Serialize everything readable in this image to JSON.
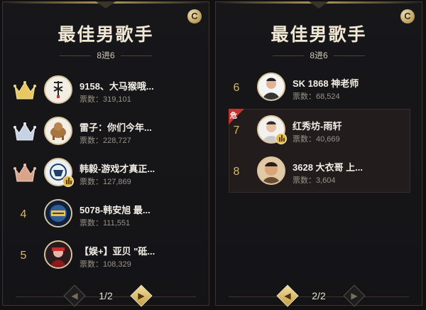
{
  "left": {
    "title": "最佳男歌手",
    "round": "8进6",
    "vote_label": "票数：",
    "items": [
      {
        "rank": "1",
        "crown": "gold",
        "name": "9158、大马猴哦...",
        "votes": "319,101"
      },
      {
        "rank": "2",
        "crown": "silver",
        "name": "雷子：你们今年...",
        "votes": "228,727"
      },
      {
        "rank": "3",
        "crown": "bronze",
        "name": "韩毅-游戏才真正...",
        "votes": "127,869"
      },
      {
        "rank": "4",
        "name": "5078-韩安旭 最...",
        "votes": "111,551"
      },
      {
        "rank": "5",
        "name": "【娱+】亚贝 \"砥...",
        "votes": "108,329"
      }
    ],
    "pagination": {
      "page": "1/2"
    }
  },
  "right": {
    "title": "最佳男歌手",
    "round": "8进6",
    "vote_label": "票数：",
    "danger_flag": "危",
    "items": [
      {
        "rank": "6",
        "name": "SK 1868 神老师",
        "votes": "68,524"
      },
      {
        "rank": "7",
        "name": "红秀坊-雨轩",
        "votes": "40,669"
      },
      {
        "rank": "8",
        "name": "3628 大衣哥 上...",
        "votes": "3,604"
      }
    ],
    "pagination": {
      "page": "2/2"
    }
  },
  "colors": {
    "accent_gold": "#d8b765",
    "danger_red": "#c9302c",
    "panel_bg": "#17171a"
  }
}
